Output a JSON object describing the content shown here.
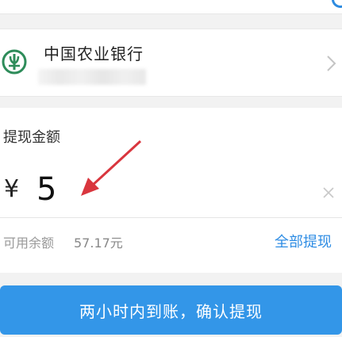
{
  "bank": {
    "name": "中国农业银行",
    "logo_icon": "abc-bank-logo-icon"
  },
  "amount": {
    "label": "提现金额",
    "currency": "¥",
    "value": "5",
    "balance_label": "可用余额",
    "balance_value": "57.17元",
    "withdraw_all": "全部提现"
  },
  "confirm": {
    "label": "两小时内到账，确认提现"
  },
  "colors": {
    "accent": "#3396e8",
    "link": "#2f8de4",
    "bank_logo": "#2e8c5a",
    "annotation_arrow": "#d9363e"
  }
}
